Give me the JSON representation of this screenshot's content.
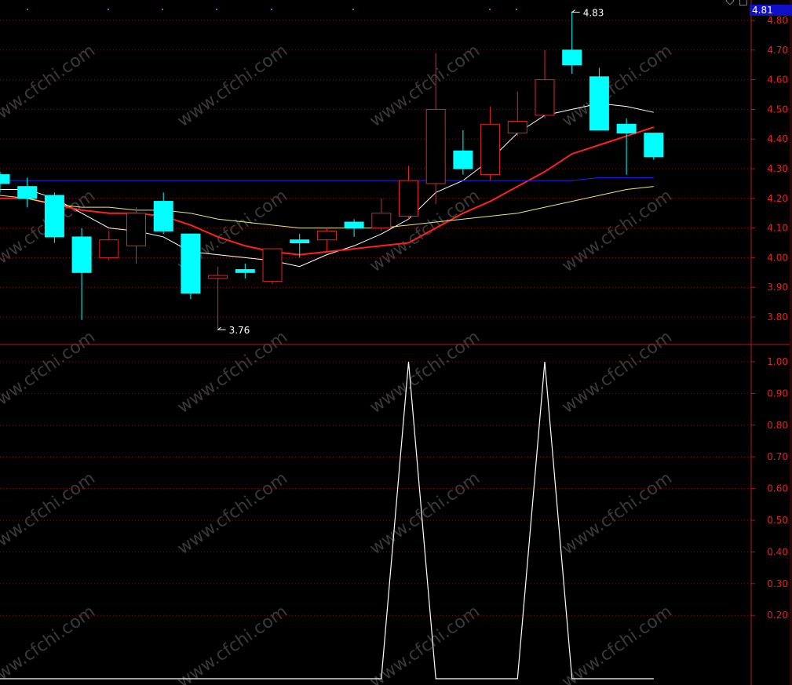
{
  "toolbar": {
    "icons": [
      "diamond-icon",
      "window-icon"
    ]
  },
  "watermark": "www.cfchi.com",
  "colors": {
    "background": "#000000",
    "up": "#e02424",
    "down": "#00ffff",
    "ma5": "#ffffff",
    "ma10": "#ff2020",
    "ma20": "#e8e87a",
    "ma60": "#2222ff",
    "axis": "#b01818",
    "tick_label": "#e02424",
    "current_price_bg": "#1010c8"
  },
  "chart_data": [
    {
      "type": "candlestick",
      "current_price": "4.81",
      "annotations": {
        "high_label": "4.83",
        "low_label": "3.76"
      },
      "y_ticks": [
        "4.80",
        "4.70",
        "4.60",
        "4.50",
        "4.40",
        "4.30",
        "4.20",
        "4.10",
        "4.00",
        "3.90",
        "3.80"
      ],
      "ylim": [
        3.71,
        4.84
      ],
      "grid": true,
      "candles": [
        {
          "o": 4.28,
          "h": 4.29,
          "l": 4.22,
          "c": 4.25
        },
        {
          "o": 4.24,
          "h": 4.27,
          "l": 4.17,
          "c": 4.2
        },
        {
          "o": 4.21,
          "h": 4.22,
          "l": 4.05,
          "c": 4.07
        },
        {
          "o": 4.07,
          "h": 4.1,
          "l": 3.79,
          "c": 3.95
        },
        {
          "o": 4.0,
          "h": 4.09,
          "l": 3.99,
          "c": 4.06
        },
        {
          "o": 4.04,
          "h": 4.17,
          "l": 3.98,
          "c": 4.15
        },
        {
          "o": 4.19,
          "h": 4.22,
          "l": 4.08,
          "c": 4.09
        },
        {
          "o": 4.08,
          "h": 4.08,
          "l": 3.86,
          "c": 3.88
        },
        {
          "o": 3.93,
          "h": 3.97,
          "l": 3.76,
          "c": 3.94
        },
        {
          "o": 3.96,
          "h": 3.98,
          "l": 3.93,
          "c": 3.95
        },
        {
          "o": 3.92,
          "h": 4.02,
          "l": 3.91,
          "c": 4.03
        },
        {
          "o": 4.06,
          "h": 4.08,
          "l": 4.0,
          "c": 4.05
        },
        {
          "o": 4.06,
          "h": 4.1,
          "l": 4.02,
          "c": 4.09
        },
        {
          "o": 4.12,
          "h": 4.13,
          "l": 4.07,
          "c": 4.1
        },
        {
          "o": 4.1,
          "h": 4.2,
          "l": 4.09,
          "c": 4.15
        },
        {
          "o": 4.14,
          "h": 4.31,
          "l": 4.13,
          "c": 4.26
        },
        {
          "o": 4.25,
          "h": 4.69,
          "l": 4.18,
          "c": 4.5
        },
        {
          "o": 4.36,
          "h": 4.43,
          "l": 4.28,
          "c": 4.3
        },
        {
          "o": 4.28,
          "h": 4.51,
          "l": 4.26,
          "c": 4.45
        },
        {
          "o": 4.42,
          "h": 4.56,
          "l": 4.41,
          "c": 4.46
        },
        {
          "o": 4.48,
          "h": 4.7,
          "l": 4.47,
          "c": 4.6
        },
        {
          "o": 4.7,
          "h": 4.83,
          "l": 4.62,
          "c": 4.65
        },
        {
          "o": 4.61,
          "h": 4.64,
          "l": 4.43,
          "c": 4.43
        },
        {
          "o": 4.45,
          "h": 4.47,
          "l": 4.28,
          "c": 4.42
        },
        {
          "o": 4.42,
          "h": 4.42,
          "l": 4.33,
          "c": 4.34
        }
      ],
      "ma_lines": [
        {
          "color_key": "ma5",
          "values": [
            4.23,
            4.23,
            4.2,
            4.15,
            4.1,
            4.09,
            4.07,
            4.02,
            4.01,
            4.0,
            3.99,
            3.97,
            4.01,
            4.04,
            4.08,
            4.13,
            4.22,
            4.26,
            4.33,
            4.42,
            4.48,
            4.5,
            4.52,
            4.51,
            4.49
          ]
        },
        {
          "color_key": "ma10",
          "values": [
            4.2,
            4.2,
            4.18,
            4.16,
            4.15,
            4.15,
            4.14,
            4.11,
            4.07,
            4.04,
            4.02,
            4.01,
            4.02,
            4.03,
            4.04,
            4.05,
            4.1,
            4.15,
            4.19,
            4.24,
            4.29,
            4.35,
            4.38,
            4.41,
            4.44
          ]
        },
        {
          "color_key": "ma20",
          "values": [
            4.21,
            4.2,
            4.18,
            4.17,
            4.17,
            4.16,
            4.16,
            4.15,
            4.13,
            4.12,
            4.11,
            4.1,
            4.1,
            4.1,
            4.1,
            4.11,
            4.12,
            4.13,
            4.14,
            4.15,
            4.17,
            4.19,
            4.21,
            4.23,
            4.24
          ]
        },
        {
          "color_key": "ma60",
          "values": [
            4.26,
            4.26,
            4.26,
            4.26,
            4.26,
            4.26,
            4.26,
            4.26,
            4.26,
            4.26,
            4.26,
            4.26,
            4.26,
            4.26,
            4.26,
            4.26,
            4.26,
            4.26,
            4.26,
            4.26,
            4.26,
            4.26,
            4.27,
            4.27,
            4.27
          ]
        }
      ]
    },
    {
      "type": "line",
      "y_ticks": [
        "1.00",
        "0.90",
        "0.80",
        "0.70",
        "0.60",
        "0.50",
        "0.40",
        "0.30",
        "0.20"
      ],
      "ylim": [
        -0.01,
        1.02
      ],
      "grid": true,
      "values": [
        0,
        0,
        0,
        0,
        0,
        0,
        0,
        0,
        0,
        0,
        0,
        0,
        0,
        0,
        0,
        1,
        0,
        0,
        0,
        0,
        1,
        0,
        0,
        0,
        0
      ]
    }
  ]
}
